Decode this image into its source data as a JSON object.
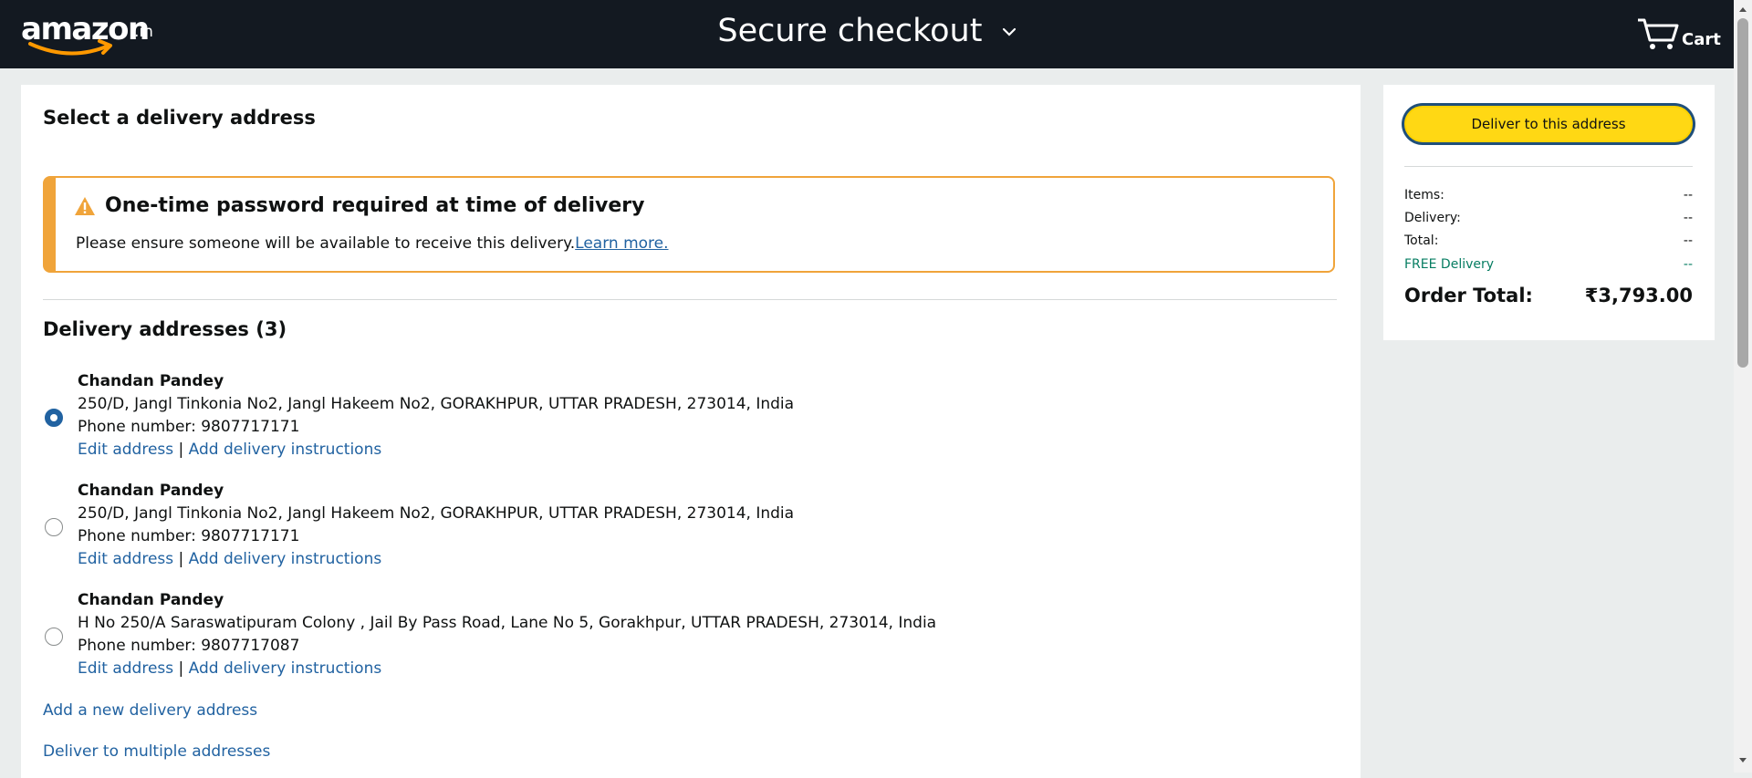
{
  "header": {
    "logo_text": "amazon",
    "logo_tld": ".in",
    "title": "Secure checkout",
    "cart_label": "Cart"
  },
  "main": {
    "section_title": "Select a delivery address",
    "alert": {
      "title": "One-time password required at time of delivery",
      "text": "Please ensure someone will be available to receive this delivery.",
      "link": "Learn more."
    },
    "addresses_heading": "Delivery addresses (3)",
    "addresses": [
      {
        "name": "Chandan Pandey",
        "address": "250/D, Jangl Tinkonia No2, Jangl Hakeem No2, GORAKHPUR, UTTAR PRADESH, 273014, India",
        "phone": "Phone number: 9807717171",
        "edit": "Edit address",
        "separator": "|",
        "instructions": "Add delivery instructions",
        "selected": true
      },
      {
        "name": "Chandan Pandey",
        "address": "250/D, Jangl Tinkonia No2, Jangl Hakeem No2, GORAKHPUR, UTTAR PRADESH, 273014, India",
        "phone": "Phone number: 9807717171",
        "edit": "Edit address",
        "separator": "|",
        "instructions": "Add delivery instructions",
        "selected": false
      },
      {
        "name": "Chandan Pandey",
        "address": "H No 250/A Saraswatipuram Colony , Jail By Pass Road, Lane No 5, Gorakhpur, UTTAR PRADESH, 273014, India",
        "phone": "Phone number: 9807717087",
        "edit": "Edit address",
        "separator": "|",
        "instructions": "Add delivery instructions",
        "selected": false
      }
    ],
    "add_address": "Add a new delivery address",
    "multiple_addresses": "Deliver to multiple addresses"
  },
  "summary": {
    "button": "Deliver to this address",
    "items_label": "Items:",
    "items_value": "--",
    "delivery_label": "Delivery:",
    "delivery_value": "--",
    "total_label": "Total:",
    "total_value": "--",
    "free_label": "FREE Delivery",
    "free_value": "--",
    "order_total_label": "Order Total:",
    "order_total_value": "₹3,793.00"
  },
  "colors": {
    "header_bg": "#131921",
    "page_bg": "#eaeded",
    "link": "#2162a1",
    "alert_border": "#f0a43a",
    "button_bg": "#ffd814",
    "free_green": "#067d62",
    "radio_selected": "#2162a1"
  },
  "icons": [
    "amazon-smile-logo",
    "chevron-down-icon",
    "cart-icon",
    "warning-icon",
    "scroll-arrow-icon"
  ]
}
